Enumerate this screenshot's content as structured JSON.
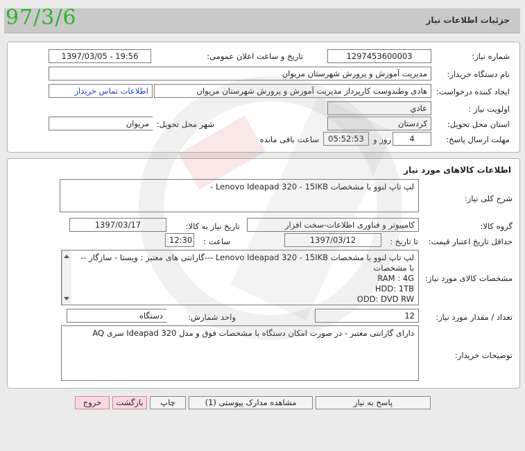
{
  "header": {
    "date_stamp": "97/3/6",
    "title": "جزئیات اطلاعات نیاز"
  },
  "need_info": {
    "need_number_label": "شماره نیاز:",
    "need_number": "1297453600003",
    "announce_label": "تاریخ و ساعت اعلان عمومی:",
    "announce_value": "1397/03/05 - 19:56",
    "buyer_org_label": "نام دستگاه خریدار:",
    "buyer_org": "مدیریت آموزش و پرورش شهرستان مریوان",
    "requester_label": "ایجاد کننده درخواست:",
    "requester": "هادی وطندوست کارپرداز مدیریت آموزش و پرورش شهرستان مریوان",
    "contact_link": "اطلاعات تماس خریدار",
    "priority_label": "اولویت نیاز :",
    "priority": "عادي",
    "province_label": "استان محل تحویل:",
    "province": "کردستان",
    "city_label": "شهر محل تحویل:",
    "city": "مریوان",
    "deadline_label": "مهلت ارسال پاسخ:",
    "deadline_days": "4",
    "days_and": "روز و",
    "deadline_time": "05:52:53",
    "remaining_label": "ساعت باقی مانده"
  },
  "goods": {
    "section_title": "اطلاعات کالاهای مورد نیاز",
    "summary_label": "شرح کلی نیاز:",
    "summary": "لپ تاپ لنوو با مشخصات  Lenovo Ideapad 320 - 15IKB -",
    "group_label": "گروه کالا:",
    "group": "کامپیوتر و فناوری اطلاعات-سخت افزار",
    "need_date_label": "تاریخ نیاز به کالا:",
    "need_date": "1397/03/17",
    "validity_label": "حداقل تاریخ اعتبار قیمت:",
    "until_date_label": "تا تاریخ :",
    "until_date": "1397/03/12",
    "time_label": "ساعت :",
    "time": "12:30",
    "specs_label": "مشخصات کالای مورد نیاز:",
    "specs_lines": [
      "لپ تاپ لنوو با مشخصات  Lenovo Ideapad 320 - 15IKB  ---گارانتی های معتبر : ویستا - سازگار --",
      "با مشخصات",
      "RAM : 4G",
      "HDD: 1TB",
      "ODD: DVD RW"
    ],
    "qty_label": "تعداد / مقدار مورد نیاز:",
    "qty": "12",
    "unit_label": "واحد شمارش:",
    "unit": "دستگاه",
    "buyer_notes_label": "توضیحات خریدار:",
    "buyer_notes": "دارای گارانتی معتبر - در صورت امکان دستگاه با مشخصات فوق و مدل Ideapad 320 سری AQ"
  },
  "buttons": {
    "reply": "پاسخ به نیاز",
    "attachments": "مشاهده مدارک پیوستی (1)",
    "print": "چاپ",
    "back": "بازگشت",
    "exit": "خروج"
  }
}
